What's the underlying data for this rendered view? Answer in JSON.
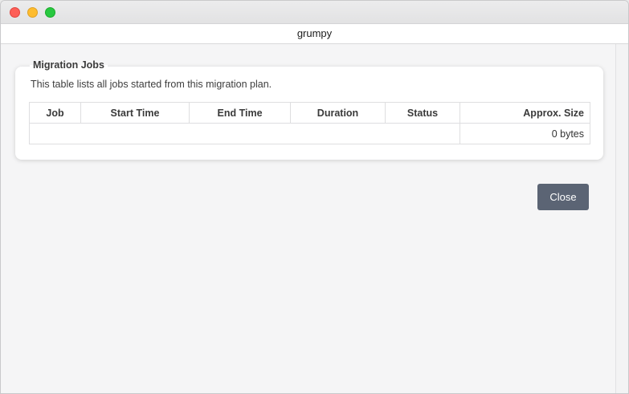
{
  "window": {
    "title": "grumpy"
  },
  "panel": {
    "legend": "Migration Jobs",
    "description": "This table lists all jobs started from this migration plan."
  },
  "table": {
    "columns": [
      "Job",
      "Start Time",
      "End Time",
      "Duration",
      "Status",
      "Approx. Size"
    ],
    "total_size": "0 bytes"
  },
  "actions": {
    "close_label": "Close"
  },
  "colors": {
    "button_bg": "#5b6474",
    "close_dot": "#fd5f57",
    "minimize_dot": "#febc2e",
    "zoom_dot": "#28c840"
  }
}
